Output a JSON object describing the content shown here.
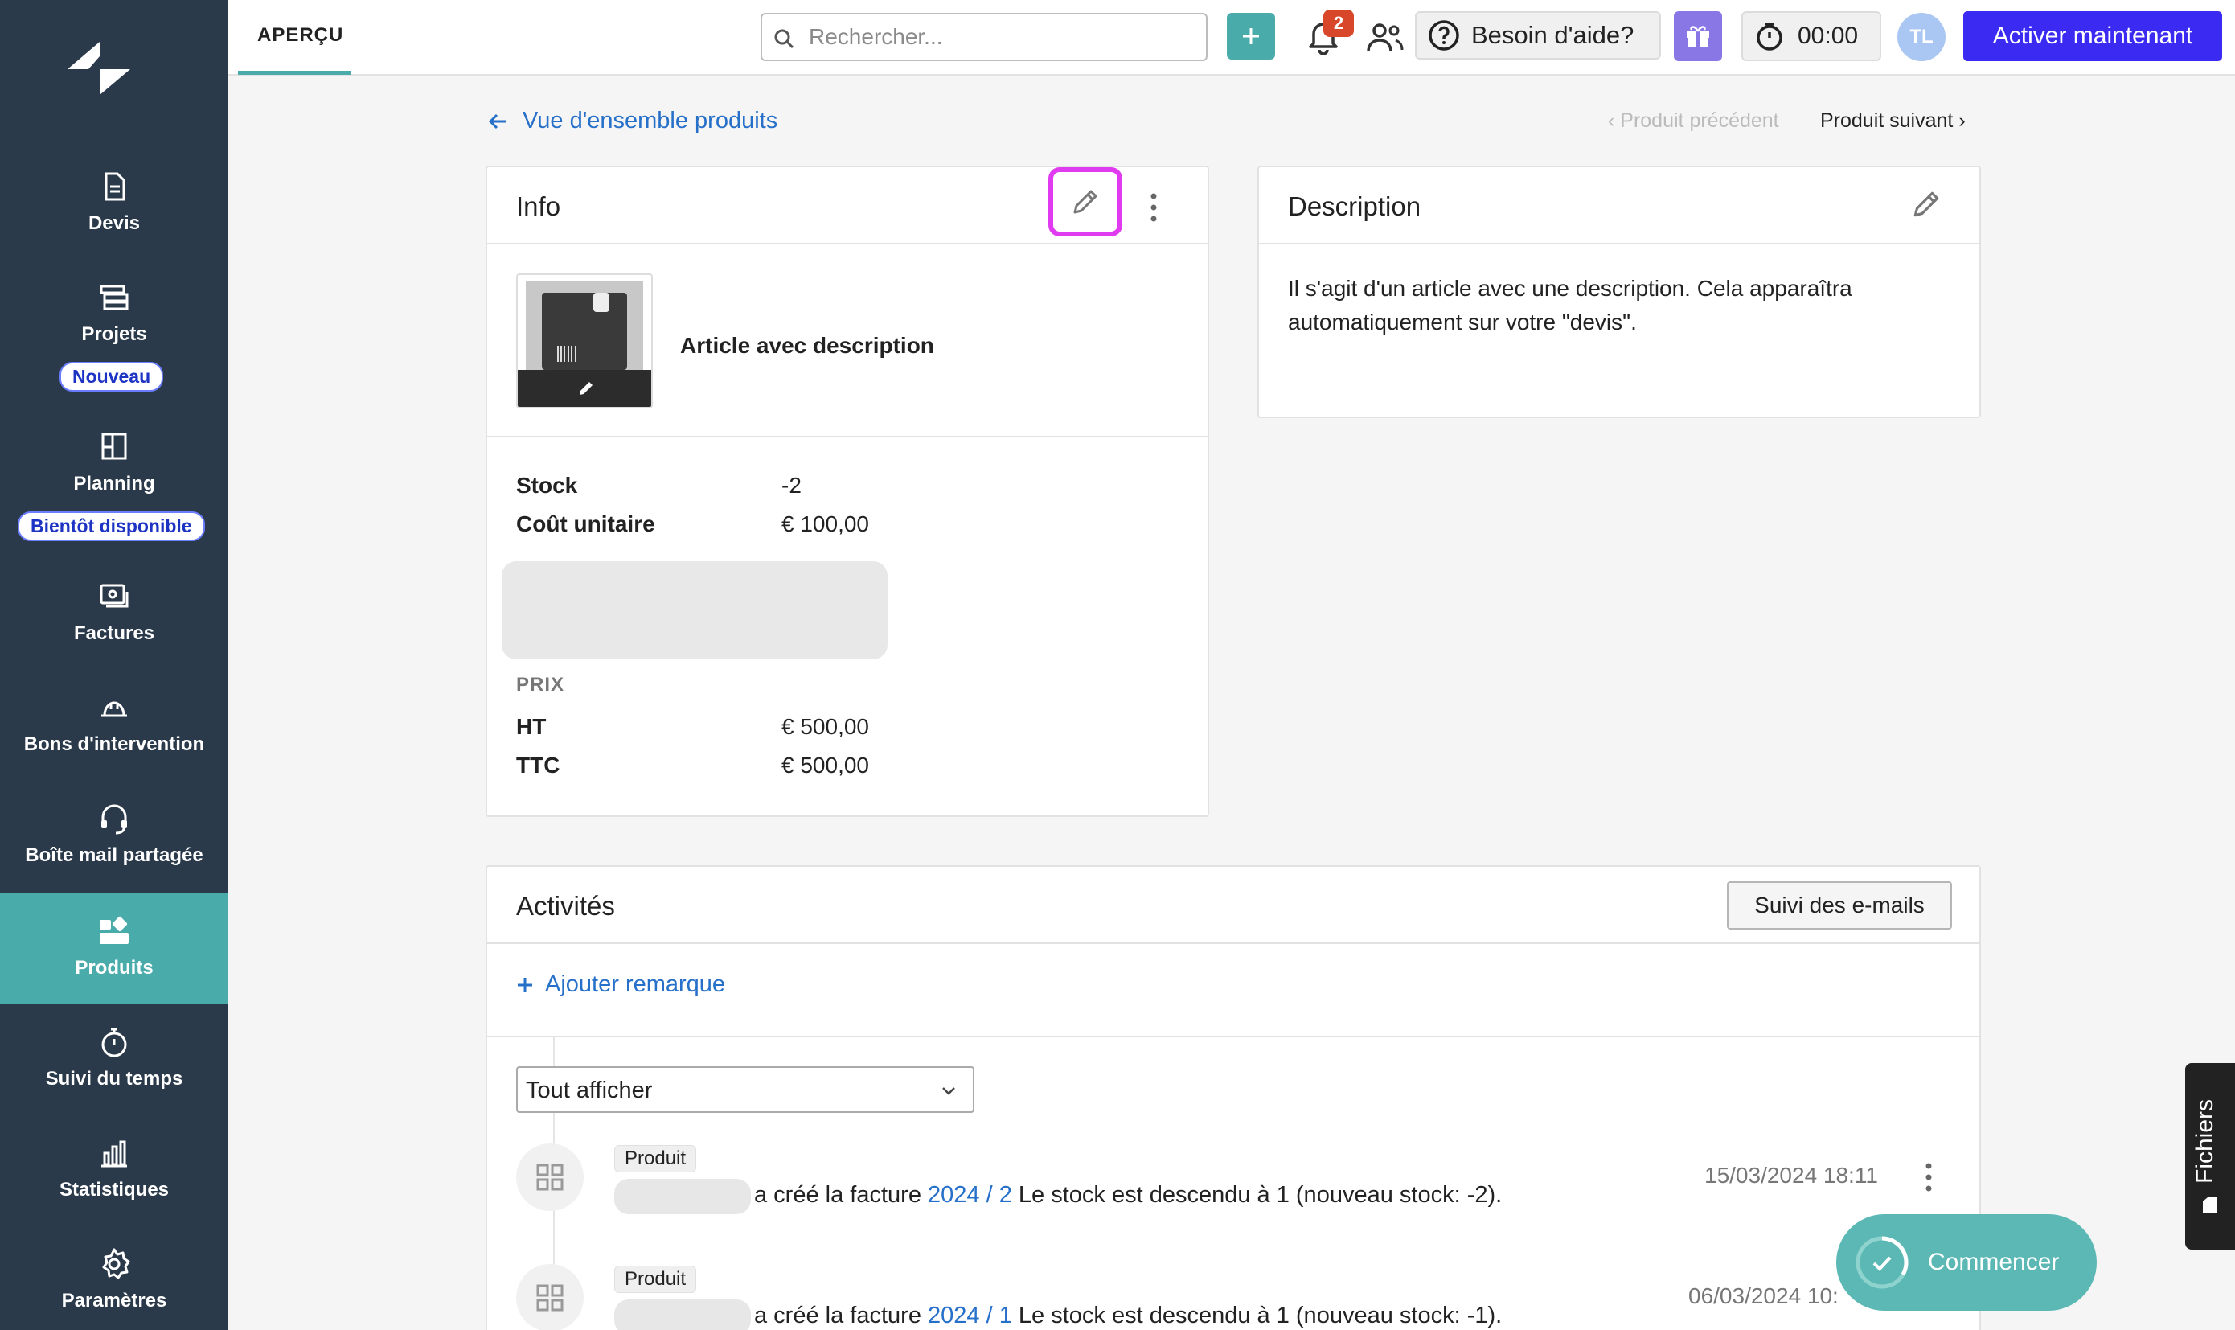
{
  "sidebar": {
    "items": [
      {
        "label": "Devis",
        "icon": "document-icon"
      },
      {
        "label": "Projets",
        "icon": "projects-icon",
        "pill": "Nouveau"
      },
      {
        "label": "Planning",
        "icon": "planning-icon",
        "pill": "Bientôt disponible"
      },
      {
        "label": "Factures",
        "icon": "invoices-icon"
      },
      {
        "label": "Bons d'intervention",
        "icon": "helmet-icon"
      },
      {
        "label": "Boîte mail partagée",
        "icon": "headset-icon"
      },
      {
        "label": "Produits",
        "icon": "products-icon",
        "active": true
      },
      {
        "label": "Suivi du temps",
        "icon": "stopwatch-icon"
      },
      {
        "label": "Statistiques",
        "icon": "stats-icon"
      },
      {
        "label": "Paramètres",
        "icon": "gear-icon"
      }
    ]
  },
  "topbar": {
    "tab": "APERÇU",
    "search_placeholder": "Rechercher...",
    "notifications_count": "2",
    "help_label": "Besoin d'aide?",
    "timer": "00:00",
    "avatar_initials": "TL",
    "activate_label": "Activer maintenant"
  },
  "breadcrumb": {
    "back": "Vue d'ensemble produits",
    "prev": "Produit précédent",
    "next": "Produit suivant"
  },
  "info": {
    "title": "Info",
    "product_name": "Article avec description",
    "stock_label": "Stock",
    "stock_value": "-2",
    "cost_label": "Coût unitaire",
    "cost_value": "€ 100,00",
    "price_heading": "PRIX",
    "ht_label": "HT",
    "ht_value": "€ 500,00",
    "ttc_label": "TTC",
    "ttc_value": "€ 500,00"
  },
  "description": {
    "title": "Description",
    "text": "Il s'agit d'un article avec une description. Cela apparaîtra automatiquement sur votre \"devis\"."
  },
  "activities": {
    "title": "Activités",
    "email_button": "Suivi des e-mails",
    "add_note": "Ajouter remarque",
    "filter": "Tout afficher",
    "items": [
      {
        "tag": "Produit",
        "pre": "a créé la facture",
        "link": "2024 / 2",
        "post": "Le stock est descendu à 1 (nouveau stock: -2).",
        "date": "15/03/2024 18:11"
      },
      {
        "tag": "Produit",
        "pre": "a créé la facture",
        "link": "2024 / 1",
        "post": "Le stock est descendu à 1 (nouveau stock: -1).",
        "date": "06/03/2024 10:"
      }
    ]
  },
  "floating": {
    "files": "Fichiers",
    "start": "Commencer"
  },
  "colors": {
    "sidebar": "#2b3a4a",
    "accent_teal": "#4aabab",
    "primary": "#3b2bf2",
    "link": "#2670c9",
    "highlight": "#e03bf0"
  }
}
